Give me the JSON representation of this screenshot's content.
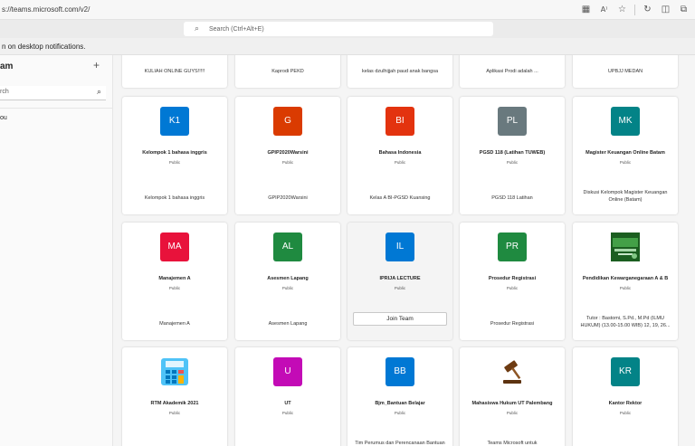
{
  "browser": {
    "url": "s://teams.microsoft.com/v2/",
    "icons": [
      "tab-grid-icon",
      "read-aloud-icon",
      "favorite-star-icon",
      "extensions-icon",
      "split-screen-icon",
      "collections-icon"
    ]
  },
  "topbar": {
    "search_placeholder": "Search (Ctrl+Alt+E)"
  },
  "notification": {
    "text": "n on desktop notifications."
  },
  "sidebar": {
    "title": "am",
    "plus": "+",
    "search_text": "rch",
    "item": "ou"
  },
  "top_row": [
    {
      "desc": "KULIAH ONLINE GUYS!!!!!"
    },
    {
      "desc": "Kaprodi PEKD"
    },
    {
      "desc": "kelas dzulhijjah paud anak bangsa"
    },
    {
      "desc": "Aplikasi Prodi adalah ..."
    },
    {
      "desc": "UPBJJ MEDAN"
    }
  ],
  "teams": [
    {
      "initials": "K1",
      "color": "#0078d4",
      "name": "Kelompok 1 bahasa inggris",
      "visibility": "Public",
      "desc": "Kelompok 1 bahasa inggris"
    },
    {
      "initials": "G",
      "color": "#da3b01",
      "name": "GPIP2020Warsini",
      "visibility": "Public",
      "desc": "GPIP2020Warsini"
    },
    {
      "initials": "BI",
      "color": "#e3330f",
      "name": "Bahasa Indonesia",
      "visibility": "Public",
      "desc": "Kelas A BI-PGSD Kuansing"
    },
    {
      "initials": "PL",
      "color": "#69797e",
      "name": "PGSD 118 (Latihan TUWEB)",
      "visibility": "Public",
      "desc": "PGSD 118 Latihan"
    },
    {
      "initials": "MK",
      "color": "#038387",
      "name": "Magister Keuangan Online Batam",
      "visibility": "Public",
      "desc": "Diskusi Kelompok Magister Keuangan Online (Batam)"
    },
    {
      "initials": "MA",
      "color": "#e8123b",
      "name": "Manajemen A",
      "visibility": "Public",
      "desc": "Manajemen A"
    },
    {
      "initials": "AL",
      "color": "#1f8a40",
      "name": "Asesmen Lapang",
      "visibility": "Public",
      "desc": "Asesmen Lapang"
    },
    {
      "initials": "IL",
      "color": "#0078d4",
      "name": "IPRIJA LECTURE",
      "visibility": "Public",
      "desc": "",
      "join": "Join Team"
    },
    {
      "initials": "PR",
      "color": "#1f8a40",
      "name": "Prosedur Registrasi",
      "visibility": "Public",
      "desc": "Prosedur Registrasi"
    },
    {
      "initials": "",
      "color": "#2e7d32",
      "name": "Pendidikan Kewarganegaraan A & B",
      "visibility": "Public",
      "desc": "Tutor : Bastomi, S.Pd., M.Pd (ILMU HUKUM) (13.00-15.00 WIB) 12, 19, 26...",
      "image": "green-banner-image"
    },
    {
      "initials": "",
      "color": "#4fc3f7",
      "name": "RTM Akademik 2021",
      "visibility": "Public",
      "desc": "",
      "image": "calculator-image"
    },
    {
      "initials": "U",
      "color": "#c30bb6",
      "name": "UT",
      "visibility": "Public",
      "desc": ""
    },
    {
      "initials": "BB",
      "color": "#0078d4",
      "name": "Bjm_Bantuan Belajar",
      "visibility": "Public",
      "desc": "Tim Perumus dan Perencanaan Bantuan"
    },
    {
      "initials": "",
      "color": "#ffffff",
      "name": "Mahasiswa Hukum UT Palembang",
      "visibility": "Public",
      "desc": "Teams Microsoft untuk",
      "image": "gavel-image"
    },
    {
      "initials": "KR",
      "color": "#038387",
      "name": "Kantor Rektor",
      "visibility": "Public",
      "desc": ""
    }
  ]
}
